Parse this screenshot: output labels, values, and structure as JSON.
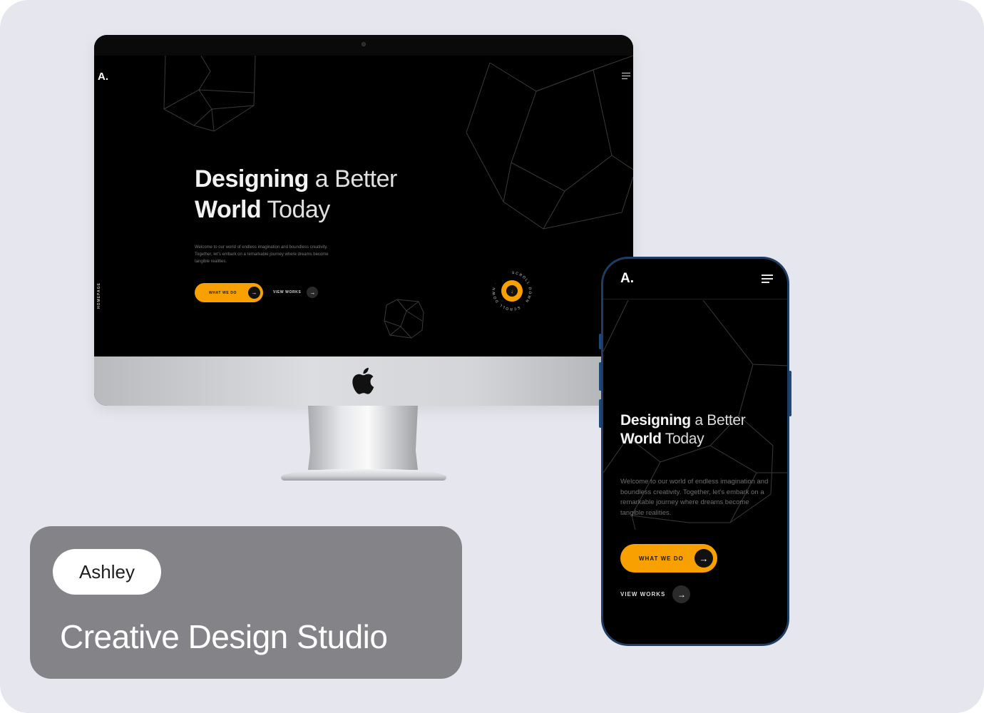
{
  "brand": {
    "logo": "A."
  },
  "desktop": {
    "side_label": "HOMEPAGE",
    "title": {
      "line1_bold": "Designing",
      "line1_light": " a Better",
      "line2_bold": "World",
      "line2_light": " Today"
    },
    "description": "Welcome to our world of endless imagination and boundless creativity. Together, let's embark on a remarkable journey where dreams become tangible realities.",
    "primary_button": "WHAT WE DO",
    "secondary_button": "VIEW WORKS",
    "scroll_label": "SCROLL DOWN · SCROLL DOWN ·"
  },
  "phone": {
    "logo": "A.",
    "title": {
      "line1_bold": "Designing",
      "line1_light": " a Better",
      "line2_bold": "World",
      "line2_light": " Today"
    },
    "description": "Welcome to our world of endless imagination and boundless creativity. Together, let's embark on a remarkable journey where dreams become tangible realities.",
    "primary_button": "WHAT WE DO",
    "secondary_button": "VIEW WORKS"
  },
  "caption": {
    "name": "Ashley",
    "title": "Creative Design Studio"
  },
  "icons": {
    "arrow_right": "→",
    "arrow_down": "↓"
  },
  "colors": {
    "accent": "#f7a000",
    "background": "#e5e6ee",
    "screen": "#000000",
    "caption_box": "#848488",
    "phone_frame": "#1f3d62"
  }
}
